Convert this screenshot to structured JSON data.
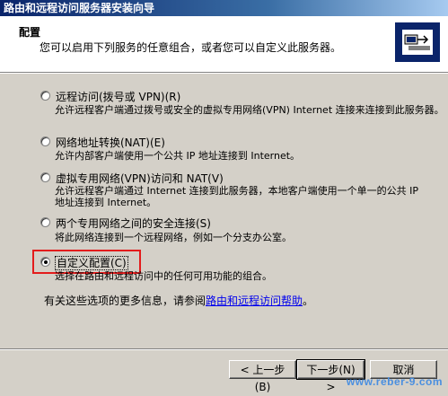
{
  "window": {
    "title": "路由和远程访问服务器安装向导"
  },
  "header": {
    "title": "配置",
    "subtitle": "您可以启用下列服务的任意组合，或者您可以自定义此服务器。"
  },
  "options": [
    {
      "label": "远程访问(拨号或 VPN)(R)",
      "description": "允许远程客户端通过拨号或安全的虚拟专用网络(VPN) Internet 连接来连接到此服务器。",
      "selected": false
    },
    {
      "label": "网络地址转换(NAT)(E)",
      "description": "允许内部客户端使用一个公共 IP 地址连接到 Internet。",
      "selected": false
    },
    {
      "label": "虚拟专用网络(VPN)访问和 NAT(V)",
      "description": "允许远程客户端通过 Internet 连接到此服务器，本地客户端使用一个单一的公共 IP 地址连接到 Internet。",
      "selected": false
    },
    {
      "label": "两个专用网络之间的安全连接(S)",
      "description": "将此网络连接到一个远程网络，例如一个分支办公室。",
      "selected": false
    },
    {
      "label": "自定义配置(C)",
      "description": "选择在路由和远程访问中的任何可用功能的组合。",
      "selected": true
    }
  ],
  "more_info": {
    "text": "有关这些选项的更多信息，请参阅",
    "link": "路由和远程访问帮助",
    "suffix": "。"
  },
  "buttons": {
    "back": "< 上一步(B)",
    "next": "下一步(N) >",
    "cancel": "取消"
  },
  "watermark": "www.reber-9.com",
  "colors": {
    "highlight": "#e31c1c",
    "link": "#0000ee",
    "titlebar": "#0a246a"
  },
  "icons": {
    "wizard": "network-server-icon"
  }
}
